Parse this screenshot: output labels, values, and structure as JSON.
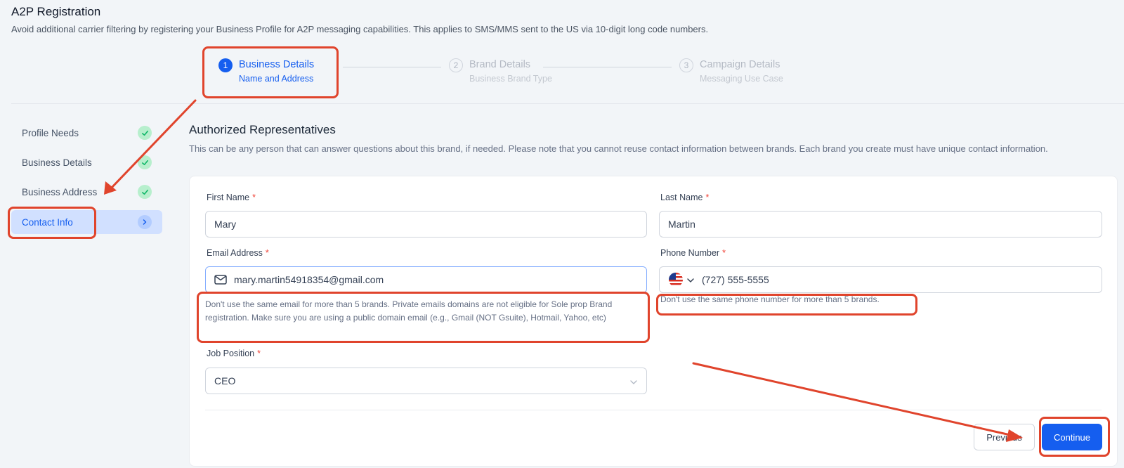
{
  "header": {
    "title": "A2P Registration",
    "subtitle": "Avoid additional carrier filtering by registering your Business Profile for A2P messaging capabilities. This applies to SMS/MMS sent to the US via 10-digit long code numbers."
  },
  "stepper": {
    "steps": [
      {
        "number": "1",
        "title": "Business Details",
        "subtitle": "Name and Address",
        "state": "active"
      },
      {
        "number": "2",
        "title": "Brand Details",
        "subtitle": "Business Brand Type",
        "state": "inactive"
      },
      {
        "number": "3",
        "title": "Campaign Details",
        "subtitle": "Messaging Use Case",
        "state": "inactive"
      }
    ]
  },
  "sidebar": {
    "items": [
      {
        "label": "Profile Needs",
        "status": "complete",
        "icon": "check-icon"
      },
      {
        "label": "Business Details",
        "status": "complete",
        "icon": "check-icon"
      },
      {
        "label": "Business Address",
        "status": "complete",
        "icon": "check-icon"
      },
      {
        "label": "Contact Info",
        "status": "current",
        "icon": "chevron-right-icon"
      }
    ]
  },
  "section": {
    "title": "Authorized Representatives",
    "description": "This can be any person that can answer questions about this brand, if needed. Please note that you cannot reuse contact information between brands. Each brand you create must have unique contact information."
  },
  "form": {
    "required_marker": "*",
    "first_name": {
      "label": "First Name",
      "value": "Mary"
    },
    "last_name": {
      "label": "Last Name",
      "value": "Martin"
    },
    "email": {
      "label": "Email Address",
      "value": "mary.martin54918354@gmail.com",
      "helper": "Don't use the same email for more than 5 brands. Private emails domains are not eligible for Sole prop Brand registration. Make sure you are using a public domain email (e.g., Gmail (NOT Gsuite), Hotmail, Yahoo, etc)"
    },
    "phone": {
      "label": "Phone Number",
      "value": "(727) 555-5555",
      "country_icon": "us-flag-icon",
      "helper": "Don't use the same phone number for more than 5 brands."
    },
    "job_position": {
      "label": "Job Position",
      "value": "CEO"
    }
  },
  "actions": {
    "previous_label": "Previous",
    "continue_label": "Continue"
  },
  "colors": {
    "primary": "#155eef",
    "annotation": "#e0442c",
    "success": "#12b76a",
    "required": "#f04438"
  }
}
